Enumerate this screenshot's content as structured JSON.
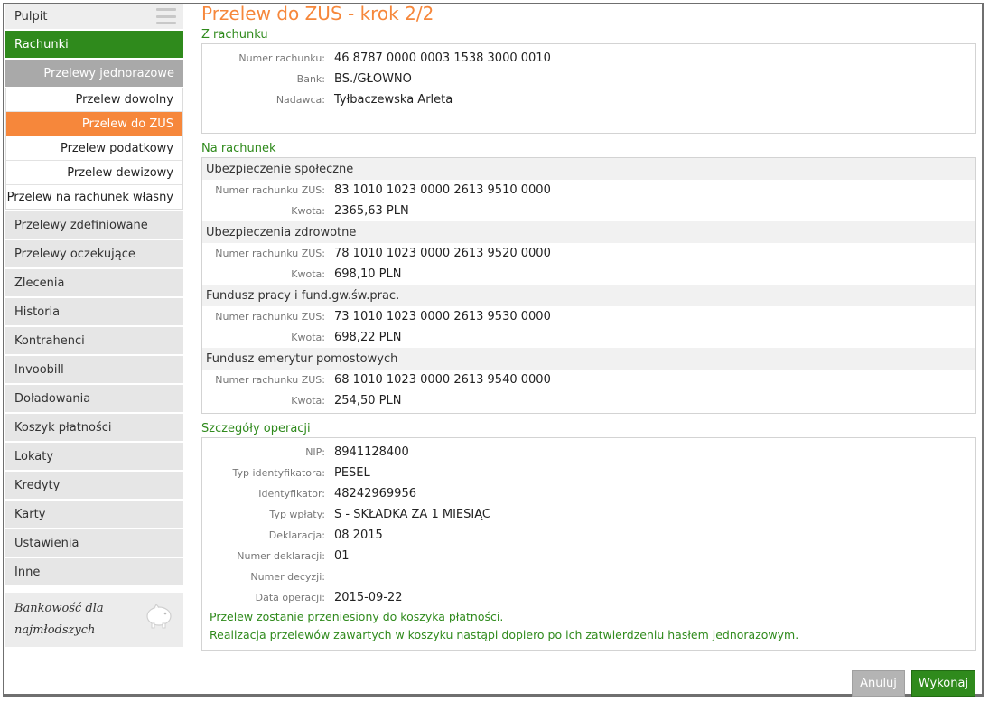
{
  "sidebar": {
    "top_label": "Pulpit",
    "active_section": "Rachunki",
    "sub_head": "Przelewy jednorazowe",
    "sub_items": [
      {
        "label": "Przelew dowolny"
      },
      {
        "label": "Przelew do ZUS"
      },
      {
        "label": "Przelew podatkowy"
      },
      {
        "label": "Przelew dewizowy"
      },
      {
        "label": "Przelew na rachunek własny"
      }
    ],
    "items": [
      "Przelewy zdefiniowane",
      "Przelewy oczekujące",
      "Zlecenia",
      "Historia",
      "Kontrahenci",
      "Invoobill",
      "Doładowania",
      "Koszyk płatności",
      "Lokaty",
      "Kredyty",
      "Karty",
      "Ustawienia",
      "Inne"
    ],
    "promo_line1": "Bankowość dla",
    "promo_line2": "najmłodszych"
  },
  "page": {
    "title": "Przelew do ZUS - krok 2/2"
  },
  "from_account": {
    "section_title": "Z rachunku",
    "rows": [
      {
        "label": "Numer rachunku:",
        "value": "46 8787 0000 0003 1538 3000 0010"
      },
      {
        "label": "Bank:",
        "value": "BS./GŁOWNO"
      },
      {
        "label": "Nadawca:",
        "value": "Tyłbaczewska Arleta"
      }
    ]
  },
  "to_account": {
    "section_title": "Na rachunek",
    "groups": [
      {
        "name": "Ubezpieczenie społeczne",
        "acc_label": "Numer rachunku ZUS:",
        "acc": "83 1010 1023 0000 2613 9510 0000",
        "amt_label": "Kwota:",
        "amt": "2365,63 PLN"
      },
      {
        "name": "Ubezpieczenia zdrowotne",
        "acc_label": "Numer rachunku ZUS:",
        "acc": "78 1010 1023 0000 2613 9520 0000",
        "amt_label": "Kwota:",
        "amt": "698,10 PLN"
      },
      {
        "name": "Fundusz pracy i fund.gw.św.prac.",
        "acc_label": "Numer rachunku ZUS:",
        "acc": "73 1010 1023 0000 2613 9530 0000",
        "amt_label": "Kwota:",
        "amt": "698,22 PLN"
      },
      {
        "name": "Fundusz emerytur pomostowych",
        "acc_label": "Numer rachunku ZUS:",
        "acc": "68 1010 1023 0000 2613 9540 0000",
        "amt_label": "Kwota:",
        "amt": "254,50 PLN"
      }
    ]
  },
  "details": {
    "section_title": "Szczegóły operacji",
    "rows": [
      {
        "label": "NIP:",
        "value": "8941128400"
      },
      {
        "label": "Typ identyfikatora:",
        "value": "PESEL"
      },
      {
        "label": "Identyfikator:",
        "value": "48242969956"
      },
      {
        "label": "Typ wpłaty:",
        "value": "S - SKŁADKA ZA 1 MIESIĄC"
      },
      {
        "label": "Deklaracja:",
        "value": "08 2015"
      },
      {
        "label": "Numer deklaracji:",
        "value": "01"
      },
      {
        "label": "Numer decyzji:",
        "value": ""
      },
      {
        "label": "Data operacji:",
        "value": "2015-09-22"
      }
    ],
    "note1": "Przelew zostanie przeniesiony do koszyka płatności.",
    "note2": "Realizacja przelewów zawartych w koszyku nastąpi dopiero po ich zatwierdzeniu hasłem jednorazowym."
  },
  "buttons": {
    "cancel": "Anuluj",
    "submit": "Wykonaj"
  },
  "colors": {
    "accent_green": "#2f8a1c",
    "accent_orange": "#f6873b"
  }
}
